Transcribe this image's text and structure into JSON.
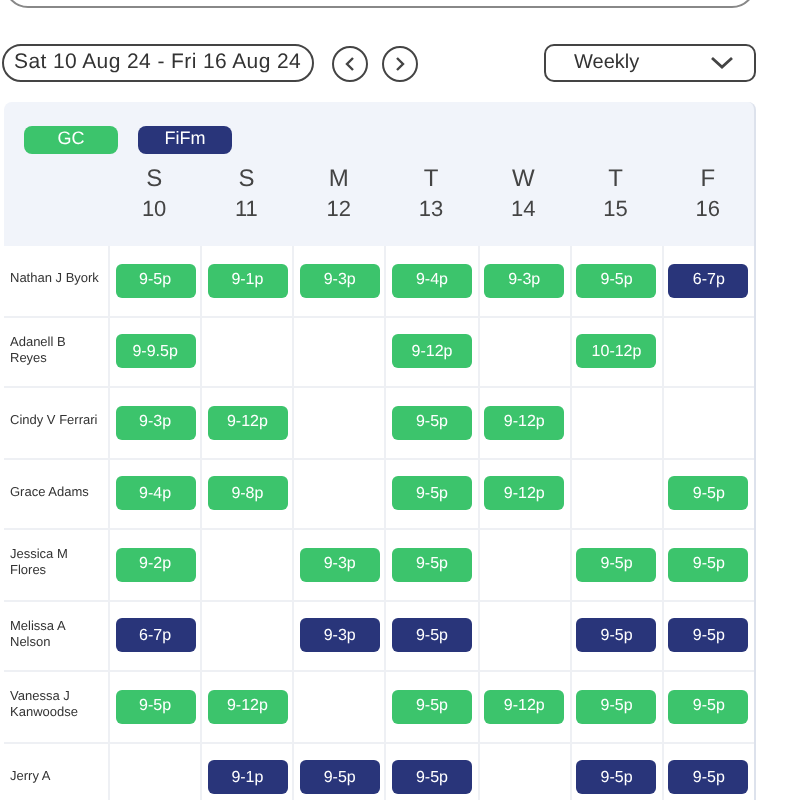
{
  "date_range": "Sat 10 Aug 24 - Fri 16 Aug 24",
  "view_select": {
    "value": "Weekly"
  },
  "legend": [
    {
      "label": "GC",
      "color": "#3cc46c"
    },
    {
      "label": "FiFm",
      "color": "#29357a"
    }
  ],
  "days": [
    {
      "letter": "S",
      "date": "10"
    },
    {
      "letter": "S",
      "date": "11"
    },
    {
      "letter": "M",
      "date": "12"
    },
    {
      "letter": "T",
      "date": "13"
    },
    {
      "letter": "W",
      "date": "14"
    },
    {
      "letter": "T",
      "date": "15"
    },
    {
      "letter": "F",
      "date": "16"
    }
  ],
  "rows": [
    {
      "name": "Nathan J Byork",
      "cells": [
        {
          "kind": "shift",
          "time": "9-5p",
          "color": "#3cc46c"
        },
        {
          "kind": "shift",
          "time": "9-1p",
          "color": "#3cc46c"
        },
        {
          "kind": "shift",
          "time": "9-3p",
          "color": "#3cc46c"
        },
        {
          "kind": "shift",
          "time": "9-4p",
          "color": "#3cc46c"
        },
        {
          "kind": "shift",
          "time": "9-3p",
          "color": "#3cc46c"
        },
        {
          "kind": "shift",
          "time": "9-5p",
          "color": "#3cc46c"
        },
        {
          "kind": "shift",
          "time": "6-7p",
          "color": "#29357a"
        }
      ]
    },
    {
      "name": "Adanell B Reyes",
      "cells": [
        {
          "kind": "shift",
          "time": "9-9.5p",
          "color": "#3cc46c"
        },
        {
          "kind": "empty"
        },
        {
          "kind": "empty"
        },
        {
          "kind": "shift",
          "time": "9-12p",
          "color": "#3cc46c"
        },
        {
          "kind": "empty"
        },
        {
          "kind": "shift",
          "time": "10-12p",
          "color": "#3cc46c"
        },
        {
          "kind": "empty"
        }
      ]
    },
    {
      "name": "Cindy V Ferrari",
      "cells": [
        {
          "kind": "shift",
          "time": "9-3p",
          "color": "#3cc46c"
        },
        {
          "kind": "shift",
          "time": "9-12p",
          "color": "#3cc46c"
        },
        {
          "kind": "empty"
        },
        {
          "kind": "shift",
          "time": "9-5p",
          "color": "#3cc46c"
        },
        {
          "kind": "shift",
          "time": "9-12p",
          "color": "#3cc46c"
        },
        {
          "kind": "empty"
        },
        {
          "kind": "empty"
        }
      ]
    },
    {
      "name": "Grace Adams",
      "cells": [
        {
          "kind": "shift",
          "time": "9-4p",
          "color": "#3cc46c"
        },
        {
          "kind": "shift",
          "time": "9-8p",
          "color": "#3cc46c"
        },
        {
          "kind": "empty"
        },
        {
          "kind": "shift",
          "time": "9-5p",
          "color": "#3cc46c"
        },
        {
          "kind": "shift",
          "time": "9-12p",
          "color": "#3cc46c"
        },
        {
          "kind": "empty"
        },
        {
          "kind": "shift",
          "time": "9-5p",
          "color": "#3cc46c"
        }
      ]
    },
    {
      "name": "Jessica M Flores",
      "cells": [
        {
          "kind": "shift",
          "time": "9-2p",
          "color": "#3cc46c"
        },
        {
          "kind": "empty"
        },
        {
          "kind": "shift",
          "time": "9-3p",
          "color": "#3cc46c"
        },
        {
          "kind": "shift",
          "time": "9-5p",
          "color": "#3cc46c"
        },
        {
          "kind": "empty"
        },
        {
          "kind": "shift",
          "time": "9-5p",
          "color": "#3cc46c"
        },
        {
          "kind": "shift",
          "time": "9-5p",
          "color": "#3cc46c"
        }
      ]
    },
    {
      "name": "Melissa A Nelson",
      "cells": [
        {
          "kind": "shift",
          "time": "6-7p",
          "color": "#29357a"
        },
        {
          "kind": "empty"
        },
        {
          "kind": "shift",
          "time": "9-3p",
          "color": "#29357a"
        },
        {
          "kind": "shift",
          "time": "9-5p",
          "color": "#29357a"
        },
        {
          "kind": "empty"
        },
        {
          "kind": "shift",
          "time": "9-5p",
          "color": "#29357a"
        },
        {
          "kind": "shift",
          "time": "9-5p",
          "color": "#29357a"
        }
      ]
    },
    {
      "name": "Vanessa J Kanwoodse",
      "cells": [
        {
          "kind": "shift",
          "time": "9-5p",
          "color": "#3cc46c"
        },
        {
          "kind": "shift",
          "time": "9-12p",
          "color": "#3cc46c"
        },
        {
          "kind": "empty"
        },
        {
          "kind": "shift",
          "time": "9-5p",
          "color": "#3cc46c"
        },
        {
          "kind": "shift",
          "time": "9-12p",
          "color": "#3cc46c"
        },
        {
          "kind": "shift",
          "time": "9-5p",
          "color": "#3cc46c"
        },
        {
          "kind": "shift",
          "time": "9-5p",
          "color": "#3cc46c"
        }
      ]
    },
    {
      "name": "Jerry A",
      "cells": [
        {
          "kind": "empty"
        },
        {
          "kind": "shift",
          "time": "9-1p",
          "color": "#29357a"
        },
        {
          "kind": "shift",
          "time": "9-5p",
          "color": "#29357a"
        },
        {
          "kind": "shift",
          "time": "9-5p",
          "color": "#29357a"
        },
        {
          "kind": "empty"
        },
        {
          "kind": "shift",
          "time": "9-5p",
          "color": "#29357a"
        },
        {
          "kind": "shift",
          "time": "9-5p",
          "color": "#29357a"
        }
      ]
    }
  ]
}
